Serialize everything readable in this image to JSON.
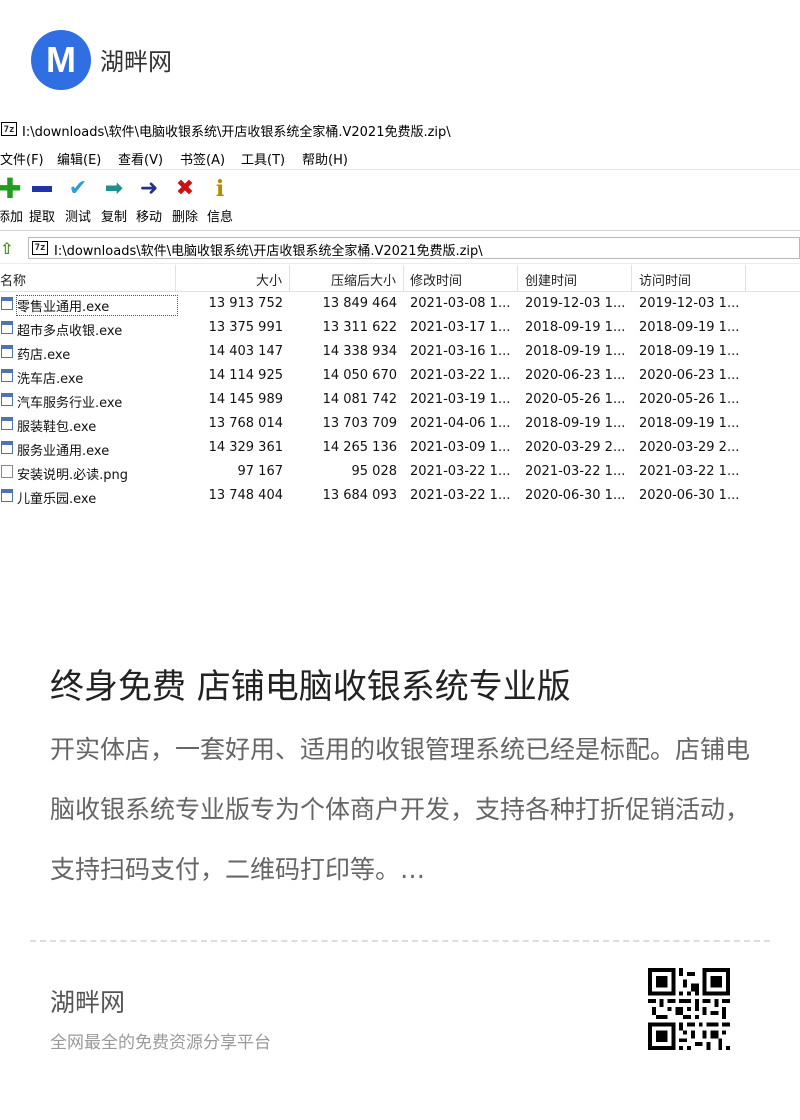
{
  "header": {
    "logo_letter": "M",
    "brand": "湖畔网"
  },
  "window": {
    "app_icon_text": "7z",
    "title": "I:\\downloads\\软件\\电脑收银系统\\开店收银系统全家桶.V2021免费版.zip\\",
    "menu": [
      "文件(F)",
      "编辑(E)",
      "查看(V)",
      "书签(A)",
      "工具(T)",
      "帮助(H)"
    ],
    "toolbar": [
      {
        "label": "添加",
        "icon": "plus-icon",
        "color": "#1f9d1f"
      },
      {
        "label": "提取",
        "icon": "minus-icon",
        "color": "#2233aa"
      },
      {
        "label": "测试",
        "icon": "check-icon",
        "color": "#2a9fd0"
      },
      {
        "label": "复制",
        "icon": "copy-arrow-icon",
        "color": "#1f8f8f"
      },
      {
        "label": "移动",
        "icon": "move-arrow-icon",
        "color": "#223388"
      },
      {
        "label": "删除",
        "icon": "delete-icon",
        "color": "#cc1111"
      },
      {
        "label": "信息",
        "icon": "info-icon",
        "color": "#b08a00"
      }
    ],
    "address": "I:\\downloads\\软件\\电脑收银系统\\开店收银系统全家桶.V2021免费版.zip\\",
    "columns": [
      "名称",
      "大小",
      "压缩后大小",
      "修改时间",
      "创建时间",
      "访问时间"
    ],
    "files": [
      {
        "name": "零售业通用.exe",
        "size": "13 913 752",
        "packed": "13 849 464",
        "mtime": "2021-03-08 1...",
        "ctime": "2019-12-03 1...",
        "atime": "2019-12-03 1..."
      },
      {
        "name": "超市多点收银.exe",
        "size": "13 375 991",
        "packed": "13 311 622",
        "mtime": "2021-03-17 1...",
        "ctime": "2018-09-19 1...",
        "atime": "2018-09-19 1..."
      },
      {
        "name": "药店.exe",
        "size": "14 403 147",
        "packed": "14 338 934",
        "mtime": "2021-03-16 1...",
        "ctime": "2018-09-19 1...",
        "atime": "2018-09-19 1..."
      },
      {
        "name": "洗车店.exe",
        "size": "14 114 925",
        "packed": "14 050 670",
        "mtime": "2021-03-22 1...",
        "ctime": "2020-06-23 1...",
        "atime": "2020-06-23 1..."
      },
      {
        "name": "汽车服务行业.exe",
        "size": "14 145 989",
        "packed": "14 081 742",
        "mtime": "2021-03-19 1...",
        "ctime": "2020-05-26 1...",
        "atime": "2020-05-26 1..."
      },
      {
        "name": "服装鞋包.exe",
        "size": "13 768 014",
        "packed": "13 703 709",
        "mtime": "2021-04-06 1...",
        "ctime": "2018-09-19 1...",
        "atime": "2018-09-19 1..."
      },
      {
        "name": "服务业通用.exe",
        "size": "14 329 361",
        "packed": "14 265 136",
        "mtime": "2021-03-09 1...",
        "ctime": "2020-03-29 2...",
        "atime": "2020-03-29 2..."
      },
      {
        "name": "安装说明.必读.png",
        "size": "97 167",
        "packed": "95 028",
        "mtime": "2021-03-22 1...",
        "ctime": "2021-03-22 1...",
        "atime": "2021-03-22 1..."
      },
      {
        "name": "儿童乐园.exe",
        "size": "13 748 404",
        "packed": "13 684 093",
        "mtime": "2021-03-22 1...",
        "ctime": "2020-06-30 1...",
        "atime": "2020-06-30 1..."
      }
    ]
  },
  "article": {
    "title": "终身免费 店铺电脑收银系统专业版",
    "description": "开实体店，一套好用、适用的收银管理系统已经是标配。店铺电脑收银系统专业版专为个体商户开发，支持各种打折促销活动，支持扫码支付，二维码打印等。…"
  },
  "footer": {
    "brand": "湖畔网",
    "tagline": "全网最全的免费资源分享平台",
    "qr_icon": "qr-code-icon"
  }
}
